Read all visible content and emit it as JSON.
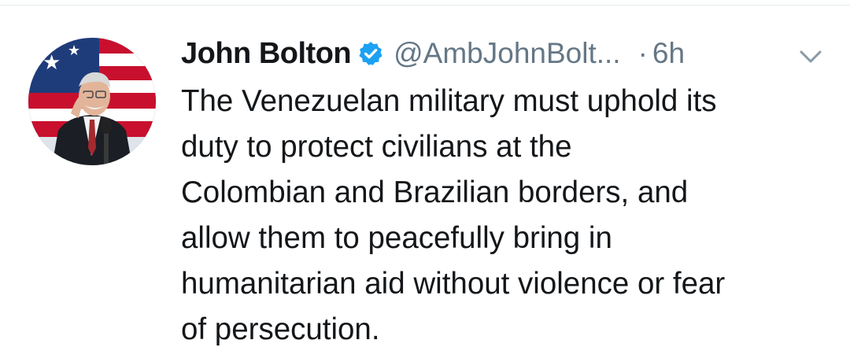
{
  "tweet": {
    "author": {
      "display_name": "John Bolton",
      "handle": "@AmbJohnBolt...",
      "verified_icon": "verified-badge-icon",
      "avatar": "avatar-photo"
    },
    "separator": "·",
    "time": "6h",
    "menu_icon": "chevron-down-icon",
    "text_lines": [
      "The Venezuelan military must uphold its",
      "duty to protect civilians at the",
      "Colombian and Brazilian borders, and",
      "allow them to peacefully bring in",
      "humanitarian aid without violence or fear",
      "of persecution."
    ]
  },
  "colors": {
    "text": "#14171a",
    "secondary": "#657786",
    "verified": "#1da1f2",
    "divider": "#e6ecf0"
  }
}
